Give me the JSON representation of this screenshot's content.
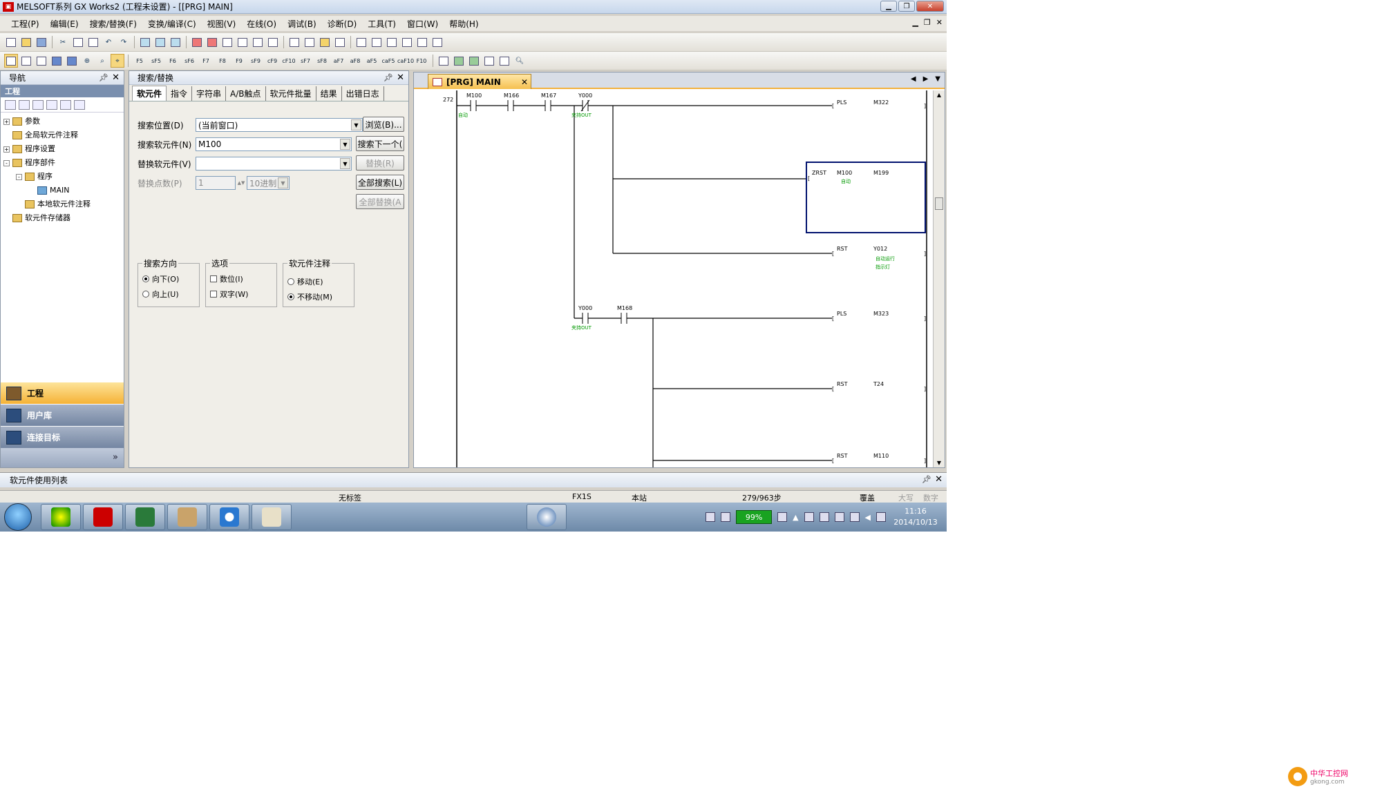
{
  "window": {
    "title": "MELSOFT系列 GX Works2 (工程未设置) - [[PRG] MAIN]"
  },
  "menu": [
    "工程(P)",
    "编辑(E)",
    "搜索/替换(F)",
    "变换/编译(C)",
    "视图(V)",
    "在线(O)",
    "调试(B)",
    "诊断(D)",
    "工具(T)",
    "窗口(W)",
    "帮助(H)"
  ],
  "toolbar_fkeys": [
    "F5",
    "sF5",
    "F6",
    "sF6",
    "F7",
    "F8",
    "F9",
    "sF9",
    "cF9",
    "cF10",
    "sF7",
    "sF8",
    "aF7",
    "aF8",
    "aF5",
    "caF5",
    "caF10",
    "F10"
  ],
  "nav": {
    "title": "导航",
    "section": "工程",
    "tree": [
      {
        "label": "参数",
        "level": 0,
        "exp": "+"
      },
      {
        "label": "全局软元件注释",
        "level": 0,
        "exp": ""
      },
      {
        "label": "程序设置",
        "level": 0,
        "exp": "+"
      },
      {
        "label": "程序部件",
        "level": 0,
        "exp": "-"
      },
      {
        "label": "程序",
        "level": 1,
        "exp": "-"
      },
      {
        "label": "MAIN",
        "level": 2,
        "exp": ""
      },
      {
        "label": "本地软元件注释",
        "level": 1,
        "exp": ""
      },
      {
        "label": "软元件存储器",
        "level": 0,
        "exp": ""
      }
    ],
    "buttons": [
      "工程",
      "用户库",
      "连接目标"
    ],
    "more": "»"
  },
  "search": {
    "title": "搜索/替换",
    "tabs": [
      "软元件",
      "指令",
      "字符串",
      "A/B触点",
      "软元件批量",
      "结果",
      "出错日志"
    ],
    "location_label": "搜索位置(D)",
    "location_value": "(当前窗口)",
    "browse": "浏览(B)...",
    "device_label": "搜索软元件(N)",
    "device_value": "M100",
    "find_next": "搜索下一个(",
    "replace_label": "替换软元件(V)",
    "replace_btn": "替换(R)",
    "count_label": "替换点数(P)",
    "count_value": "1",
    "radix": "10进制",
    "find_all": "全部搜索(L)",
    "replace_all": "全部替换(A",
    "dir_title": "搜索方向",
    "dir_down": "向下(O)",
    "dir_up": "向上(U)",
    "opt_title": "选项",
    "opt_digit": "数位(I)",
    "opt_double": "双字(W)",
    "cmt_title": "软元件注释",
    "cmt_move": "移动(E)",
    "cmt_nomove": "不移动(M)"
  },
  "editor": {
    "tab_label": "[PRG] MAIN",
    "step": "272",
    "rows": [
      {
        "contacts": [
          {
            "dev": "M100",
            "cmt": "自动"
          },
          {
            "dev": "M166",
            "cmt": ""
          },
          {
            "dev": "M167",
            "cmt": ""
          },
          {
            "dev": "Y000",
            "cmt": "夹持OUT"
          }
        ],
        "coil": {
          "ins": "PLS",
          "op1": "M322"
        }
      },
      {
        "coil": {
          "ins": "ZRST",
          "op1": "M100",
          "op1cmt": "自动",
          "op2": "M199"
        }
      },
      {
        "coil": {
          "ins": "RST",
          "op1": "Y012",
          "op1cmt": "自动运行",
          "op1cmt2": "指示灯"
        }
      },
      {
        "contacts": [
          {
            "dev": "Y000",
            "cmt": "夹持OUT"
          },
          {
            "dev": "M168",
            "cmt": ""
          }
        ],
        "coil": {
          "ins": "PLS",
          "op1": "M323"
        }
      },
      {
        "coil": {
          "ins": "RST",
          "op1": "T24"
        }
      },
      {
        "coil": {
          "ins": "RST",
          "op1": "M110"
        }
      }
    ]
  },
  "devlist": {
    "title": "软元件使用列表"
  },
  "status": {
    "label": "无标签",
    "cpu": "FX1S",
    "station": "本站",
    "steps": "279/963步",
    "mode": "覆盖",
    "caps": "大写",
    "num": "数字"
  },
  "taskbar": {
    "battery": "99%",
    "time": "11:16",
    "date": "2014/10/13"
  },
  "watermark": {
    "site": "中华工控网",
    "url": "gkong.com"
  }
}
